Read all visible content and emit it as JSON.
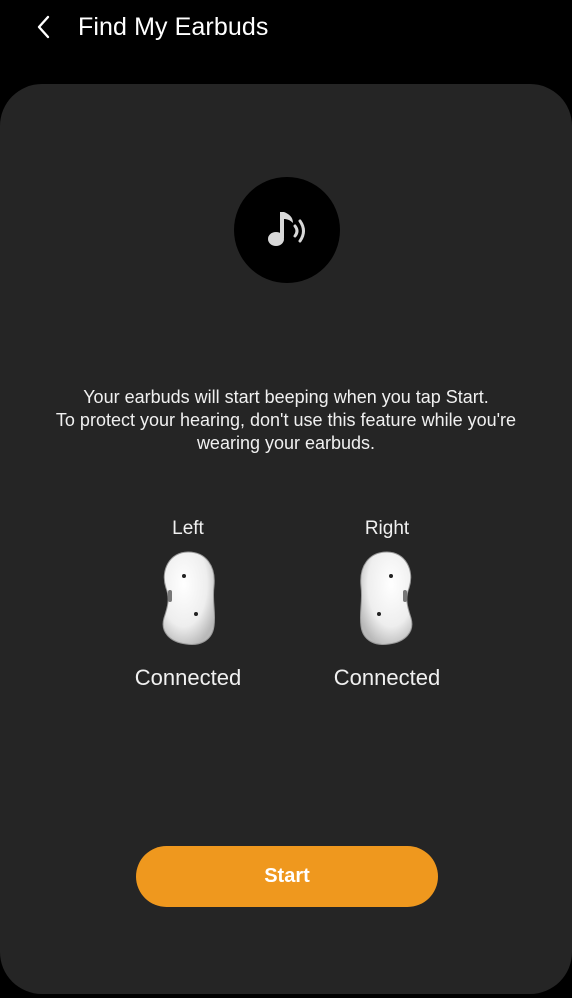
{
  "header": {
    "back_icon": "chevron-left-icon",
    "title": "Find My Earbuds"
  },
  "main": {
    "sound_icon": "music-note-sound-icon",
    "description": {
      "line1": "Your earbuds will start beeping when you tap Start.",
      "line2": "To protect your hearing, don't use this feature while you're",
      "line3": "wearing your earbuds."
    },
    "earbuds": [
      {
        "label": "Left",
        "status": "Connected"
      },
      {
        "label": "Right",
        "status": "Connected"
      }
    ],
    "start_label": "Start"
  },
  "colors": {
    "background": "#000000",
    "card": "#252525",
    "accent": "#ef981e",
    "text": "#ffffff"
  }
}
